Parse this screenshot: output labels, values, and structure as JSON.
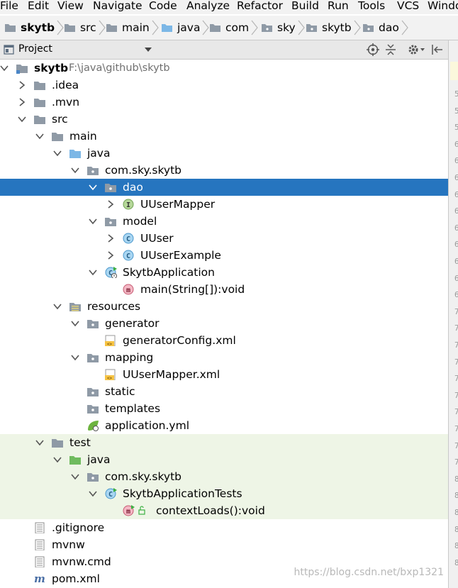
{
  "menu": [
    "File",
    "Edit",
    "View",
    "Navigate",
    "Code",
    "Analyze",
    "Refactor",
    "Build",
    "Run",
    "Tools",
    "VCS",
    "Windo"
  ],
  "breadcrumb": [
    "skytb",
    "src",
    "main",
    "java",
    "com",
    "sky",
    "skytb",
    "dao"
  ],
  "project_panel": {
    "title": "Project"
  },
  "tree": [
    {
      "label": "skytb",
      "extra": "F:\\java\\github\\skytb",
      "icon": "module-folder-icon",
      "arrow": "down",
      "indent": 0
    },
    {
      "label": ".idea",
      "icon": "folder-icon",
      "arrow": "right",
      "indent": 1
    },
    {
      "label": ".mvn",
      "icon": "folder-icon",
      "arrow": "right",
      "indent": 1
    },
    {
      "label": "src",
      "icon": "folder-icon",
      "arrow": "down",
      "indent": 1
    },
    {
      "label": "main",
      "icon": "folder-icon",
      "arrow": "down",
      "indent": 2
    },
    {
      "label": "java",
      "icon": "source-folder-icon",
      "arrow": "down",
      "indent": 3
    },
    {
      "label": "com.sky.skytb",
      "icon": "package-icon",
      "arrow": "down",
      "indent": 4
    },
    {
      "label": "dao",
      "icon": "package-icon",
      "arrow": "down",
      "indent": 5,
      "selected": true
    },
    {
      "label": "UUserMapper",
      "icon": "interface-icon",
      "arrow": "right",
      "indent": 6
    },
    {
      "label": "model",
      "icon": "package-icon",
      "arrow": "down",
      "indent": 5
    },
    {
      "label": "UUser",
      "icon": "class-icon",
      "arrow": "right",
      "indent": 6
    },
    {
      "label": "UUserExample",
      "icon": "class-icon",
      "arrow": "right",
      "indent": 6
    },
    {
      "label": "SkytbApplication",
      "icon": "spring-boot-class-icon",
      "arrow": "down",
      "indent": 5
    },
    {
      "label": "main(String[]):void",
      "icon": "method-icon",
      "arrow": "none",
      "indent": 6
    },
    {
      "label": "resources",
      "icon": "resources-folder-icon",
      "arrow": "down",
      "indent": 3
    },
    {
      "label": "generator",
      "icon": "package-icon",
      "arrow": "down",
      "indent": 4
    },
    {
      "label": "generatorConfig.xml",
      "icon": "xml-file-icon",
      "arrow": "none",
      "indent": 5
    },
    {
      "label": "mapping",
      "icon": "package-icon",
      "arrow": "down",
      "indent": 4
    },
    {
      "label": "UUserMapper.xml",
      "icon": "xml-file-icon",
      "arrow": "none",
      "indent": 5
    },
    {
      "label": "static",
      "icon": "package-icon",
      "arrow": "none",
      "indent": 4
    },
    {
      "label": "templates",
      "icon": "package-icon",
      "arrow": "none",
      "indent": 4
    },
    {
      "label": "application.yml",
      "icon": "spring-config-icon",
      "arrow": "none",
      "indent": 4
    },
    {
      "label": "test",
      "icon": "folder-icon",
      "arrow": "down",
      "indent": 2,
      "test": true
    },
    {
      "label": "java",
      "icon": "test-folder-icon",
      "arrow": "down",
      "indent": 3,
      "test": true
    },
    {
      "label": "com.sky.skytb",
      "icon": "package-icon",
      "arrow": "down",
      "indent": 4,
      "test": true
    },
    {
      "label": "SkytbApplicationTests",
      "icon": "test-class-icon",
      "arrow": "down",
      "indent": 5,
      "test": true
    },
    {
      "label": "contextLoads():void",
      "icon": "test-method-icon",
      "arrow": "none",
      "indent": 6,
      "test": true
    },
    {
      "label": ".gitignore",
      "icon": "text-file-icon",
      "arrow": "none",
      "indent": 1
    },
    {
      "label": "mvnw",
      "icon": "text-file-icon",
      "arrow": "none",
      "indent": 1
    },
    {
      "label": "mvnw.cmd",
      "icon": "text-file-icon",
      "arrow": "none",
      "indent": 1
    },
    {
      "label": "pom.xml",
      "icon": "maven-icon",
      "arrow": "none",
      "indent": 1
    }
  ],
  "editor_line_numbers": [
    "5",
    "5",
    "5",
    "6",
    "6",
    "6",
    "6",
    "6",
    "6",
    "6",
    "6",
    "6",
    "6",
    "7",
    "7",
    "7",
    "7",
    "7",
    "7",
    "7",
    "7",
    "7",
    "7",
    "8",
    "8",
    "8",
    "8",
    "8",
    "8"
  ],
  "watermark": "https://blog.csdn.net/bxp1321",
  "colors": {
    "selection": "#2675bf",
    "test_bg": "#eef5e6",
    "folder": "#8f9aa6",
    "source_folder": "#7cb7e6",
    "test_folder": "#6fbb5e"
  }
}
